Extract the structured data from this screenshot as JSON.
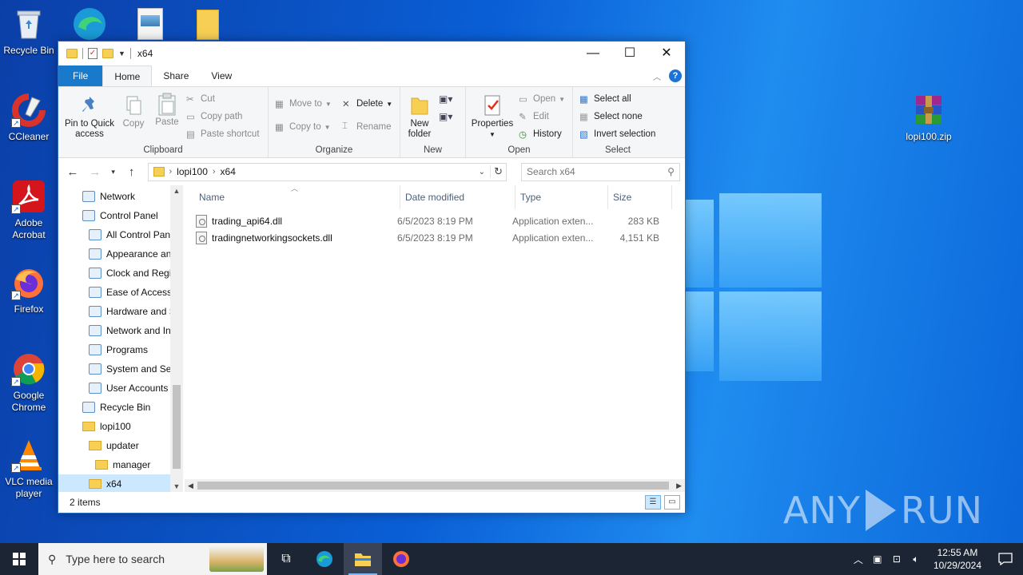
{
  "desktop": {
    "icons_left": [
      {
        "label": "Recycle Bin",
        "icon": "recycle-bin-icon"
      },
      {
        "label": "CCleaner",
        "icon": "ccleaner-icon"
      },
      {
        "label": "Adobe Acrobat",
        "icon": "adobe-acrobat-icon"
      },
      {
        "label": "Firefox",
        "icon": "firefox-icon"
      },
      {
        "label": "Google Chrome",
        "icon": "chrome-icon"
      },
      {
        "label": "VLC media player",
        "icon": "vlc-icon"
      }
    ],
    "icon_right": {
      "label": "lopi100.zip",
      "icon": "winrar-archive-icon"
    },
    "watermark": {
      "left": "ANY",
      "right": "RUN"
    }
  },
  "window": {
    "title": "x64",
    "controls": {
      "minimize": "—",
      "maximize": "☐",
      "close": "✕"
    },
    "tabs": [
      "File",
      "Home",
      "Share",
      "View"
    ],
    "ribbon": {
      "clipboard": {
        "label": "Clipboard",
        "pin": "Pin to Quick access",
        "copy": "Copy",
        "paste": "Paste",
        "cut": "Cut",
        "copy_path": "Copy path",
        "paste_shortcut": "Paste shortcut"
      },
      "organize": {
        "label": "Organize",
        "move_to": "Move to",
        "copy_to": "Copy to",
        "delete": "Delete",
        "rename": "Rename"
      },
      "new": {
        "label": "New",
        "new_folder": "New folder"
      },
      "open": {
        "label": "Open",
        "properties": "Properties",
        "open": "Open",
        "edit": "Edit",
        "history": "History"
      },
      "select": {
        "label": "Select",
        "select_all": "Select all",
        "select_none": "Select none",
        "invert": "Invert selection"
      }
    },
    "address": {
      "crumbs": [
        "lopi100",
        "x64"
      ]
    },
    "search_placeholder": "Search x64",
    "nav_items": [
      {
        "label": "Network",
        "indent": 1,
        "icon": "network-icon"
      },
      {
        "label": "Control Panel",
        "indent": 1,
        "icon": "control-panel-icon"
      },
      {
        "label": "All Control Panel Items",
        "indent": 2,
        "icon": "control-panel-icon"
      },
      {
        "label": "Appearance and Personalization",
        "indent": 2,
        "icon": "appearance-icon"
      },
      {
        "label": "Clock and Region",
        "indent": 2,
        "icon": "clock-icon"
      },
      {
        "label": "Ease of Access",
        "indent": 2,
        "icon": "ease-of-access-icon"
      },
      {
        "label": "Hardware and Sound",
        "indent": 2,
        "icon": "hardware-icon"
      },
      {
        "label": "Network and Internet",
        "indent": 2,
        "icon": "network-internet-icon"
      },
      {
        "label": "Programs",
        "indent": 2,
        "icon": "programs-icon"
      },
      {
        "label": "System and Security",
        "indent": 2,
        "icon": "shield-icon"
      },
      {
        "label": "User Accounts",
        "indent": 2,
        "icon": "user-accounts-icon"
      },
      {
        "label": "Recycle Bin",
        "indent": 1,
        "icon": "recycle-bin-icon"
      },
      {
        "label": "lopi100",
        "indent": 1,
        "icon": "folder-icon"
      },
      {
        "label": "updater",
        "indent": 2,
        "icon": "folder-icon"
      },
      {
        "label": "manager",
        "indent": 3,
        "icon": "folder-icon"
      },
      {
        "label": "x64",
        "indent": 2,
        "icon": "folder-icon",
        "selected": true
      }
    ],
    "columns": [
      "Name",
      "Date modified",
      "Type",
      "Size"
    ],
    "files": [
      {
        "name": "trading_api64.dll",
        "date": "6/5/2023 8:19 PM",
        "type": "Application exten...",
        "size": "283 KB"
      },
      {
        "name": "tradingnetworkingsockets.dll",
        "date": "6/5/2023 8:19 PM",
        "type": "Application exten...",
        "size": "4,151 KB"
      }
    ],
    "status": "2 items"
  },
  "taskbar": {
    "search_placeholder": "Type here to search",
    "time": "12:55 AM",
    "date": "10/29/2024"
  },
  "colors": {
    "accent": "#1979ca",
    "taskbar": "#1c2533",
    "selection": "#cce8ff"
  }
}
